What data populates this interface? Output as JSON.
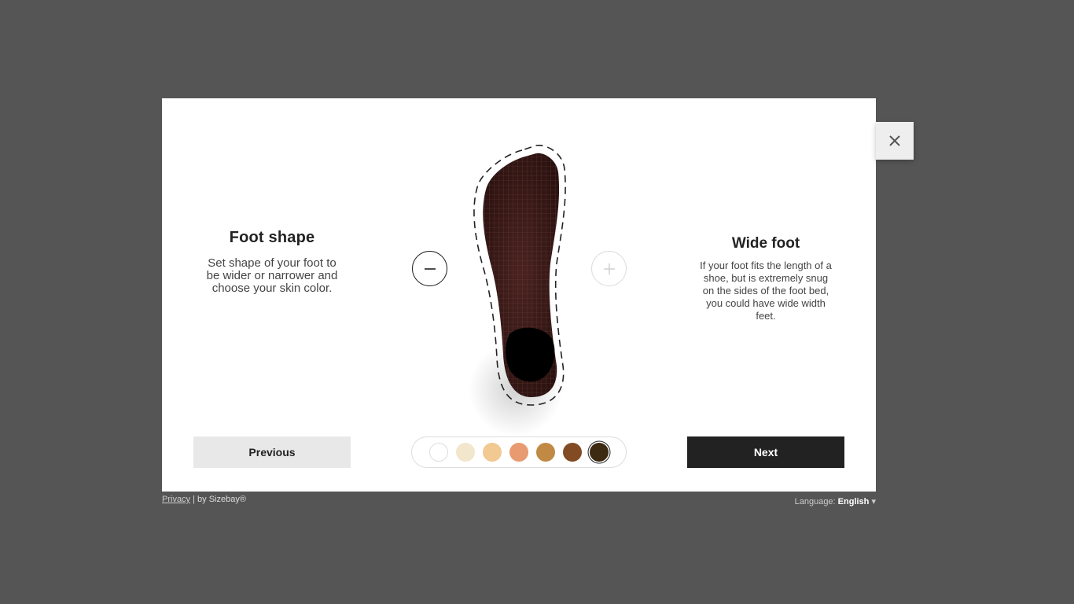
{
  "left": {
    "title": "Foot shape",
    "description": "Set shape of your foot to be wider or narrower and choose your skin color."
  },
  "right": {
    "title": "Wide foot",
    "description": "If your foot fits the length of a shoe, but is extremely snug on the sides of the foot bed, you could have wide width feet."
  },
  "controls": {
    "minus_icon": "minus-icon",
    "plus_icon": "plus-icon"
  },
  "skin_colors": [
    "#ffffff",
    "#f2e6cc",
    "#f2c993",
    "#e89a70",
    "#c08a45",
    "#834b23",
    "#3c2a12"
  ],
  "selected_skin_index": 6,
  "buttons": {
    "previous": "Previous",
    "next": "Next"
  },
  "footer": {
    "privacy": "Privacy",
    "separator": "|",
    "brand": "by Sizebay®",
    "language_label": "Language:",
    "language_value": "English",
    "language_caret": "▾"
  },
  "close_icon": "close-icon"
}
